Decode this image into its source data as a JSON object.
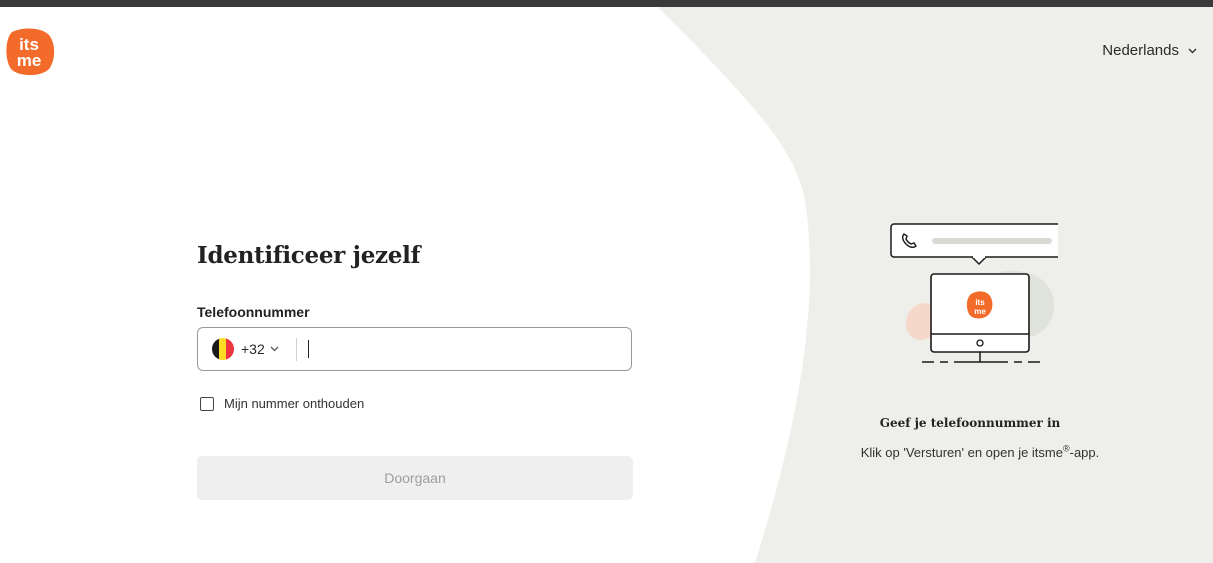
{
  "brand": {
    "logo_text_top": "its",
    "logo_text_bottom": "me",
    "color": "#f26b2a"
  },
  "header": {
    "language": "Nederlands"
  },
  "form": {
    "title": "Identificeer jezelf",
    "phone_label": "Telefoonnummer",
    "country_code": "+32",
    "country_flag": "belgium-flag",
    "phone_value": "",
    "remember_label": "Mijn nummer onthouden",
    "remember_checked": false,
    "continue_label": "Doorgaan"
  },
  "side": {
    "title": "Geef je telefoonnummer in",
    "text_before": "Klik op 'Versturen' en open je itsme",
    "registered": "®",
    "text_after": "-app."
  },
  "colors": {
    "accent": "#f26b2a",
    "panel": "#eeeeea",
    "button_disabled": "#efefef"
  }
}
